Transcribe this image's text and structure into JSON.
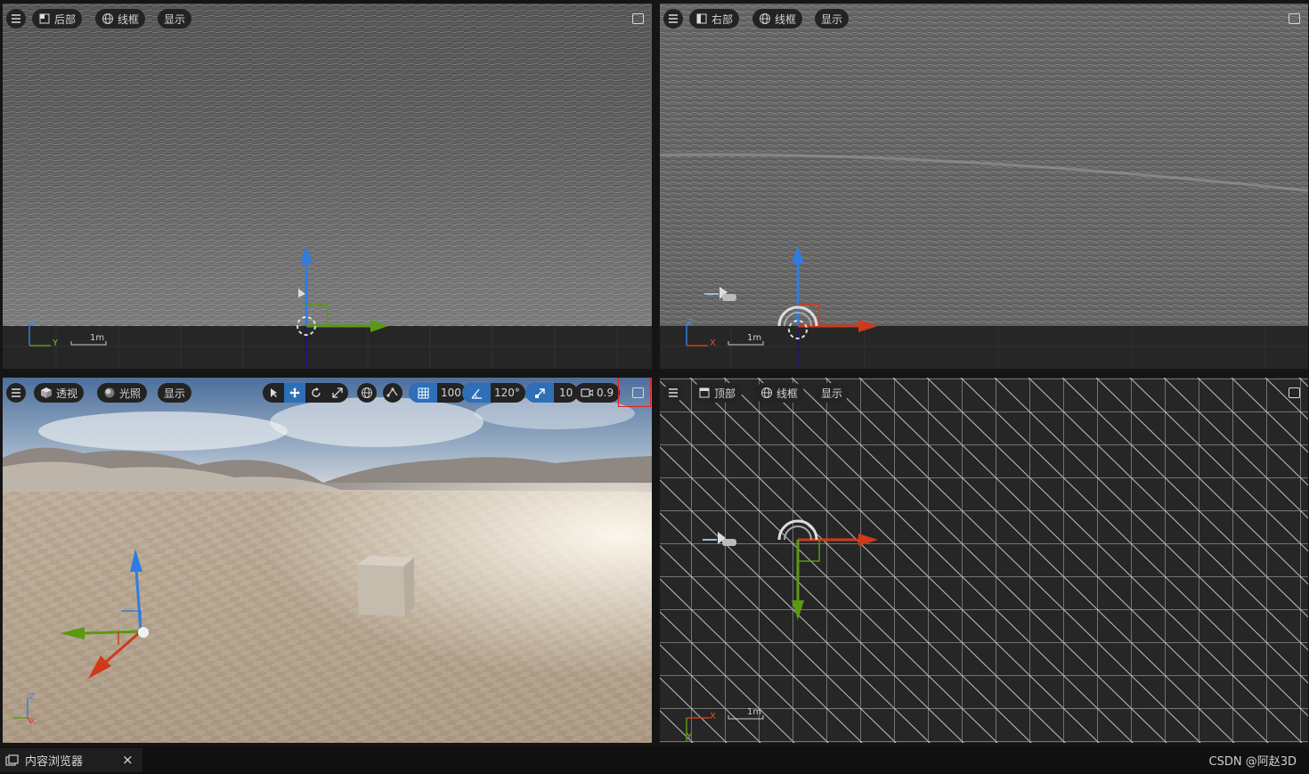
{
  "viewports": {
    "back": {
      "view_label": "后部",
      "mode_label": "线框",
      "show_label": "显示",
      "axis_v": "Z",
      "axis_h": "Y",
      "scale": "1m"
    },
    "right": {
      "view_label": "右部",
      "mode_label": "线框",
      "show_label": "显示",
      "axis_v": "Z",
      "axis_h": "X",
      "scale": "1m"
    },
    "persp": {
      "view_label": "透视",
      "mode_label": "光照",
      "show_label": "显示",
      "grid_snap": "100",
      "rot_snap": "120°",
      "scale_snap": "10",
      "cam_speed": "0.9",
      "axis_v": "Z",
      "axis_h": "Y",
      "axis_x": "X"
    },
    "top": {
      "view_label": "顶部",
      "mode_label": "线框",
      "show_label": "显示",
      "axis_h": "X",
      "axis_v": "Y",
      "scale": "1m"
    }
  },
  "statusbar": {
    "tab_label": "内容浏览器",
    "close": "×",
    "credit": "CSDN @阿赵3D"
  },
  "icons": [
    "menu-icon",
    "back-view-icon",
    "right-view-icon",
    "top-view-icon",
    "perspective-cube-icon",
    "wireframe-sphere-icon",
    "lit-sphere-icon",
    "select-arrow-icon",
    "move-icon",
    "rotate-icon",
    "scale-icon",
    "world-globe-icon",
    "surface-snap-icon",
    "grid-snap-icon",
    "angle-snap-icon",
    "scale-snap-icon",
    "camera-icon",
    "maximize-icon",
    "close-icon"
  ],
  "colors": {
    "accent": "#2e6fb8",
    "highlight": "#e02020",
    "axis_x": "#d03a1a",
    "axis_y": "#5a9a12",
    "axis_z": "#2f7de0"
  }
}
